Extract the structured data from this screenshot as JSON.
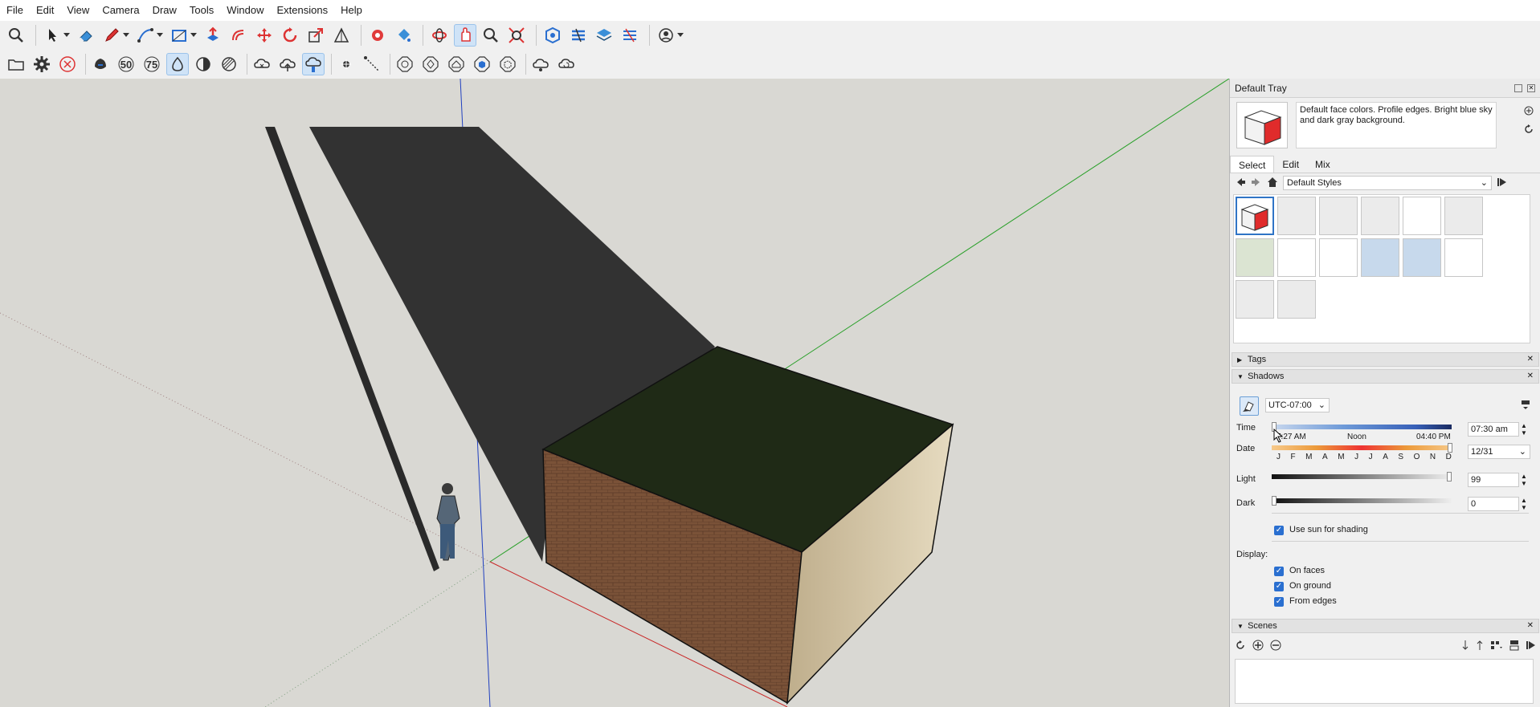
{
  "menu": [
    "File",
    "Edit",
    "View",
    "Camera",
    "Draw",
    "Tools",
    "Window",
    "Extensions",
    "Help"
  ],
  "toolbar1_icons": [
    "zoom-icon",
    "select-arrow-icon",
    "eraser-icon",
    "pencil-line-icon",
    "arc-tool-icon",
    "rectangle-tool-icon",
    "push-pull-icon",
    "offset-icon",
    "move-icon",
    "rotate-icon",
    "scale-icon",
    "follow-me-icon",
    "tape-measure-icon",
    "paint-bucket-icon",
    "orbit-icon",
    "pan-icon",
    "zoom-window-icon",
    "zoom-extents-icon",
    "components-icon",
    "materials-icon",
    "layers-icon",
    "extensions-icon",
    "account-icon"
  ],
  "toolbar2_icons": [
    "open-folder-icon",
    "settings-gear-icon",
    "close-x-icon",
    "opacity-icon",
    "level-50-icon",
    "level-75-icon",
    "drop-icon",
    "half-contrast-icon",
    "hatched-circle-icon",
    "cloud-x-icon",
    "cloud-upload-icon",
    "cloud-hand-icon",
    "dot-icon",
    "dotted-line-icon",
    "octagon-refresh-icon",
    "octagon-ring-icon",
    "house-icon",
    "cube-icon",
    "dashed-cube-icon",
    "cloud-sync-icon",
    "cloud-refresh-icon"
  ],
  "toolbar2_labels": {
    "n50": "50",
    "n75": "75"
  },
  "tray": {
    "title": "Default Tray",
    "style_description": "Default face colors. Profile edges. Bright blue sky and dark gray background.",
    "tabs": [
      "Select",
      "Edit",
      "Mix"
    ],
    "active_tab": "Select",
    "collection": "Default Styles"
  },
  "panels": {
    "tags": "Tags",
    "shadows": "Shadows",
    "scenes": "Scenes"
  },
  "shadows": {
    "timezone": "UTC-07:00",
    "time_label": "Time",
    "time_start": "7:27 AM",
    "time_mid": "Noon",
    "time_end": "04:40 PM",
    "time_value": "07:30 am",
    "date_label": "Date",
    "months": [
      "J",
      "F",
      "M",
      "A",
      "M",
      "J",
      "J",
      "A",
      "S",
      "O",
      "N",
      "D"
    ],
    "date_value": "12/31",
    "light_label": "Light",
    "light_value": "99",
    "dark_label": "Dark",
    "dark_value": "0",
    "use_sun": "Use sun for shading",
    "display_label": "Display:",
    "on_faces": "On faces",
    "on_ground": "On ground",
    "from_edges": "From edges"
  },
  "colors": {
    "sky": "#d9d8d3",
    "shadow": "#323232",
    "roof": "#1f2a16",
    "axis_blue": "#2040c0",
    "axis_green": "#2aa02a",
    "axis_red": "#c82828",
    "selection_blue": "#2f74c6"
  }
}
